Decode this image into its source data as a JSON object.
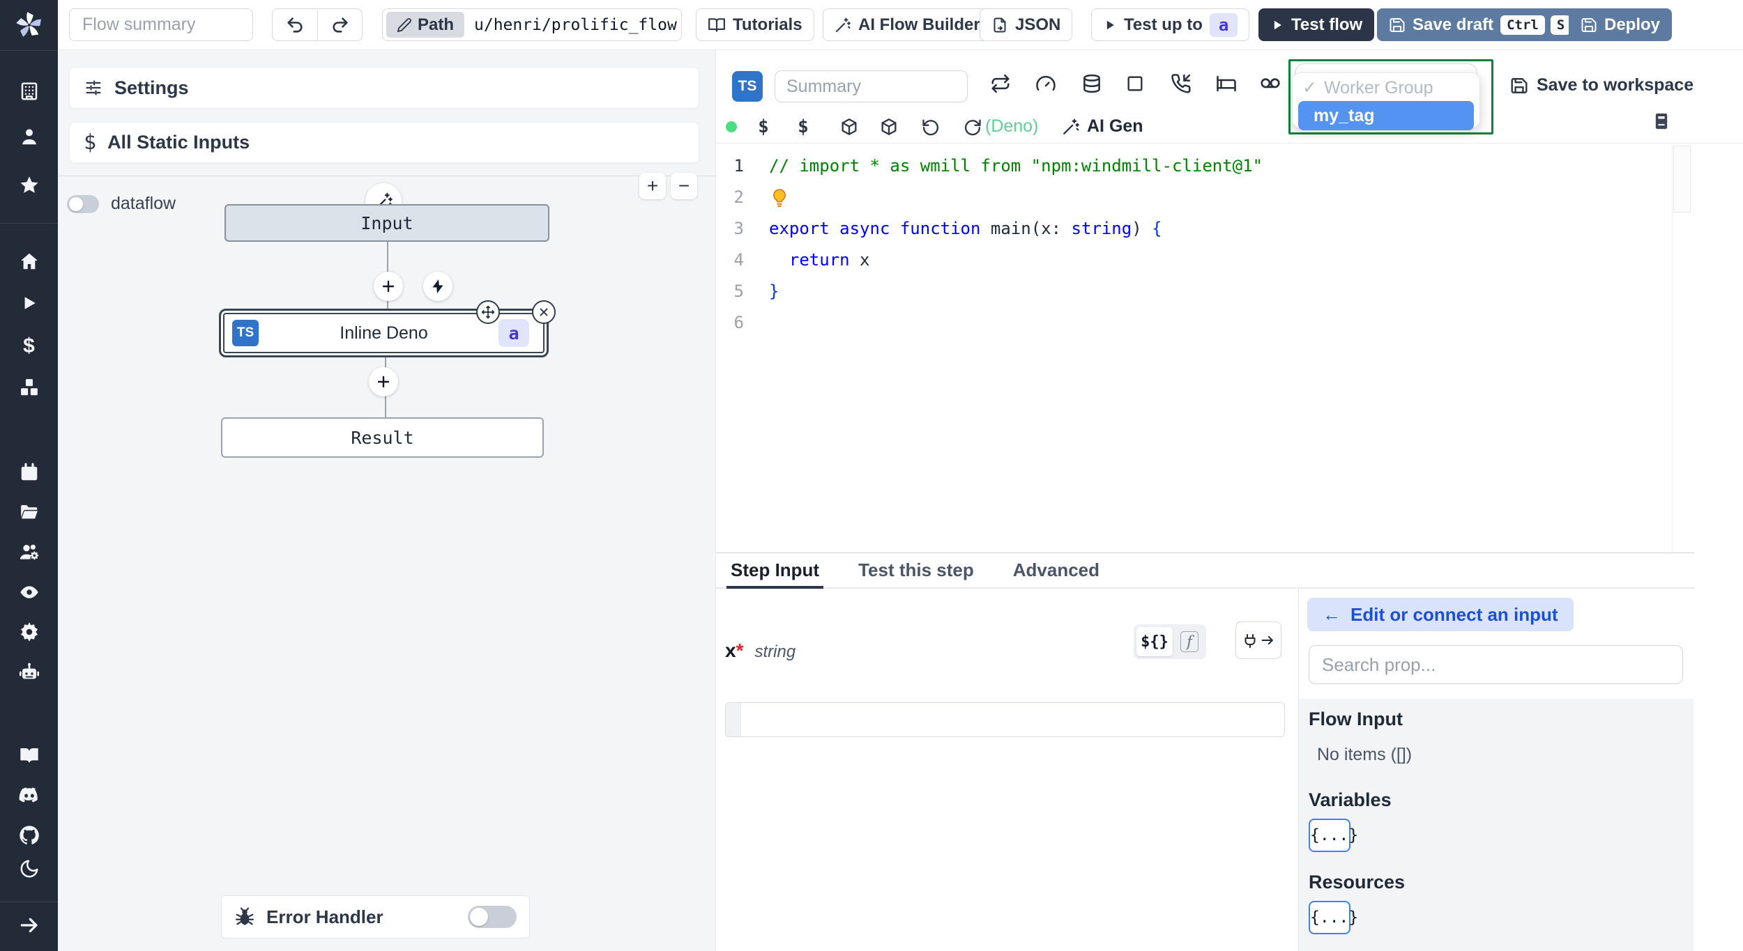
{
  "colors": {
    "sidebar_bg": "#242b38",
    "ts_badge_blue": "#2f74c8",
    "steel_button": "#5d7aa0",
    "dark_button": "#2b3547",
    "dropdown_border_green": "#15803d",
    "selected_option_blue": "#5493f2",
    "badge_indigo_bg": "#e0e4fd",
    "badge_indigo_text": "#4338ca",
    "status_dot_green": "#4ade80",
    "deno_green": "#5fce96",
    "edit_pill_bg": "#d9e3fb",
    "edit_pill_text": "#1d4ed8",
    "chip_border_blue": "#3b82f6",
    "required_red": "#dc2626",
    "comment_green": "#008000",
    "keyword_blue": "#0000ff"
  },
  "header": {
    "flow_summary_placeholder": "Flow summary",
    "path_label": "Path",
    "path_value": "u/henri/prolific_flow",
    "tutorials_label": "Tutorials",
    "ai_flow_builder_label": "AI Flow Builder",
    "json_label": "JSON",
    "test_up_to_label": "Test up to",
    "test_up_to_badge": "a",
    "test_flow_label": "Test flow",
    "save_draft_label": "Save draft",
    "save_draft_kbd": [
      "Ctrl",
      "S"
    ],
    "deploy_label": "Deploy"
  },
  "sidebar": {
    "icons": [
      "windmill-logo",
      "building",
      "user",
      "star",
      "home",
      "play",
      "dollar",
      "boxes",
      "calendar",
      "folder-open",
      "users-settings",
      "eye",
      "settings-gear",
      "bot",
      "book-open",
      "discord",
      "github",
      "moon",
      "arrow-right"
    ]
  },
  "flow_panel": {
    "settings_label": "Settings",
    "all_static_inputs_label": "All Static Inputs",
    "dataflow_label": "dataflow",
    "zoom_in_label": "+",
    "zoom_out_label": "−",
    "input_node_label": "Input",
    "step_node": {
      "lang_badge": "TS",
      "label": "Inline Deno",
      "id_badge": "a"
    },
    "result_node_label": "Result",
    "error_handler_label": "Error Handler"
  },
  "editor_panel": {
    "lang_badge": "TS",
    "summary_placeholder": "Summary",
    "runtime_label": "(Deno)",
    "ai_gen_label": "AI Gen",
    "save_to_workspace_label": "Save to workspace",
    "worker_group_dropdown": {
      "check": "✓",
      "placeholder": "Worker Group",
      "selected_option": "my_tag"
    },
    "code": {
      "active_line": 1,
      "lines": [
        {
          "n": 1,
          "tokens": [
            [
              "cm",
              "// import * as wmill from \"npm:windmill-client@1\""
            ]
          ]
        },
        {
          "n": 2,
          "tokens": [
            [
              "bulb",
              ""
            ]
          ]
        },
        {
          "n": 3,
          "tokens": [
            [
              "kw",
              "export"
            ],
            [
              "pl",
              " "
            ],
            [
              "kw",
              "async"
            ],
            [
              "pl",
              " "
            ],
            [
              "kw",
              "function"
            ],
            [
              "pl",
              " "
            ],
            [
              "fn",
              "main"
            ],
            [
              "pl",
              "(x: "
            ],
            [
              "kw",
              "string"
            ],
            [
              "pl",
              ") "
            ],
            [
              "br",
              "{"
            ]
          ]
        },
        {
          "n": 4,
          "tokens": [
            [
              "pl",
              "  "
            ],
            [
              "kw",
              "return"
            ],
            [
              "pl",
              " x"
            ]
          ]
        },
        {
          "n": 5,
          "tokens": [
            [
              "br",
              "}"
            ]
          ]
        },
        {
          "n": 6,
          "tokens": []
        }
      ]
    }
  },
  "step_panel": {
    "tabs": [
      "Step Input",
      "Test this step",
      "Advanced"
    ],
    "active_tab": "Step Input",
    "field": {
      "name": "x",
      "required_mark": "*",
      "type": "string",
      "value": ""
    },
    "template_btn": "${}",
    "function_btn": "f",
    "edit_connect": {
      "arrow": "←",
      "label": "Edit or connect an input"
    },
    "search_placeholder": "Search prop...",
    "prop_picker": {
      "flow_input_label": "Flow Input",
      "flow_input_empty": "No items ([])",
      "variables_label": "Variables",
      "variables_chip": "{...}",
      "resources_label": "Resources",
      "resources_chip": "{...}"
    }
  }
}
